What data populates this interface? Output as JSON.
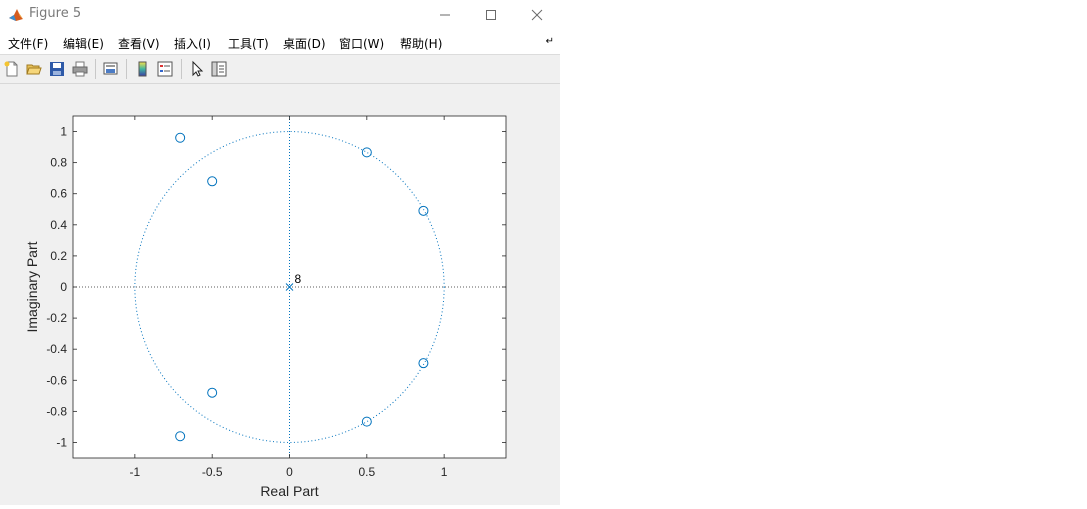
{
  "window": {
    "title": "Figure 5",
    "icon": "matlab-icon",
    "controls": [
      "minimize-icon",
      "maximize-icon",
      "close-icon"
    ]
  },
  "menu": {
    "items": [
      "文件(F)",
      "编辑(E)",
      "查看(V)",
      "插入(I)",
      "工具(T)",
      "桌面(D)",
      "窗口(W)",
      "帮助(H)"
    ],
    "more_icon": "dock-arrow-icon"
  },
  "toolbar": {
    "buttons": [
      "new-figure-icon",
      "open-file-icon",
      "save-icon",
      "print-icon",
      "link-plot-icon",
      "colorbar-icon",
      "legend-icon",
      "pointer-icon",
      "property-editor-icon"
    ]
  },
  "chart_data": {
    "type": "scatter",
    "xlabel": "Real Part",
    "ylabel": "Imaginary Part",
    "xlim": [
      -1.4,
      1.4
    ],
    "ylim": [
      -1.1,
      1.1
    ],
    "xticks": [
      -1,
      -0.5,
      0,
      0.5,
      1
    ],
    "yticks": [
      -1,
      -0.8,
      -0.6,
      -0.4,
      -0.2,
      0,
      0.2,
      0.4,
      0.6,
      0.8,
      1
    ],
    "xtick_labels": [
      "-1",
      "-0.5",
      "0",
      "0.5",
      "1"
    ],
    "ytick_labels": [
      "-1",
      "-0.8",
      "-0.6",
      "-0.4",
      "-0.2",
      "0",
      "0.2",
      "0.4",
      "0.6",
      "0.8",
      "1"
    ],
    "zeros": [
      {
        "x": -0.707,
        "y": 0.96
      },
      {
        "x": -0.5,
        "y": 0.68
      },
      {
        "x": 0.5,
        "y": 0.866
      },
      {
        "x": 0.866,
        "y": 0.49
      },
      {
        "x": 0.866,
        "y": -0.49
      },
      {
        "x": 0.5,
        "y": -0.866
      },
      {
        "x": -0.5,
        "y": -0.68
      },
      {
        "x": -0.707,
        "y": -0.96
      }
    ],
    "poles": [
      {
        "x": 0,
        "y": 0,
        "multiplicity_label": "8"
      }
    ],
    "unit_circle": true,
    "grid": false,
    "marker_color": "#0072bd"
  }
}
